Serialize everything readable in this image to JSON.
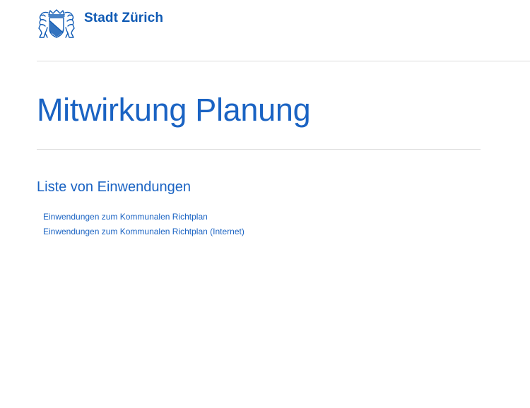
{
  "header": {
    "logo_icon": "zurich-coat-of-arms-icon",
    "brand_text": "Stadt Zürich"
  },
  "main": {
    "title": "Mitwirkung Planung",
    "section_title": "Liste von Einwendungen",
    "links": [
      {
        "label": "Einwendungen zum Kommunalen Richtplan"
      },
      {
        "label": "Einwendungen zum Kommunalen Richtplan (Internet)"
      }
    ]
  },
  "colors": {
    "brand_blue": "#0f5ab4",
    "text_blue": "#1a63c3",
    "divider": "#dcdcdc",
    "background": "#ffffff"
  }
}
